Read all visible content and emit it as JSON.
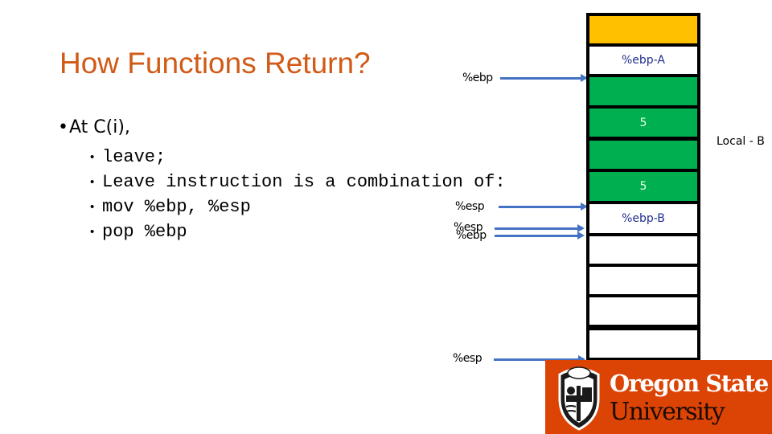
{
  "slide": {
    "title": "How Functions Return?",
    "bullet_main": "At C(i),",
    "code_bullets": [
      "leave;",
      "Leave instruction is a combination of:",
      "mov %ebp, %esp",
      "pop %ebp"
    ]
  },
  "pointers": {
    "ebp_top": "%ebp",
    "esp_after_mov": "%esp",
    "esp_after_pop": "%esp",
    "ebp_after_pop": "%ebp",
    "esp_bottom": "%esp"
  },
  "stack": {
    "cells": [
      {
        "label": "",
        "color": "yellow"
      },
      {
        "label": "%ebp-A",
        "color": "white"
      },
      {
        "label": "",
        "color": "green"
      },
      {
        "label": "5",
        "color": "green"
      },
      {
        "label": "",
        "color": "green"
      },
      {
        "label": "5",
        "color": "green"
      },
      {
        "label": "%ebp-B",
        "color": "white"
      },
      {
        "label": "",
        "color": "white"
      },
      {
        "label": "",
        "color": "white"
      },
      {
        "label": "",
        "color": "white"
      },
      {
        "label": "",
        "color": "white"
      }
    ],
    "side_label": "Local - B"
  },
  "logo": {
    "line1": "Oregon State",
    "line2": "University"
  },
  "colors": {
    "title": "#D15A16",
    "arrow": "#4472C4",
    "stack_yellow": "#FFC000",
    "stack_green": "#00B050",
    "logo_bg": "#DC4405"
  }
}
